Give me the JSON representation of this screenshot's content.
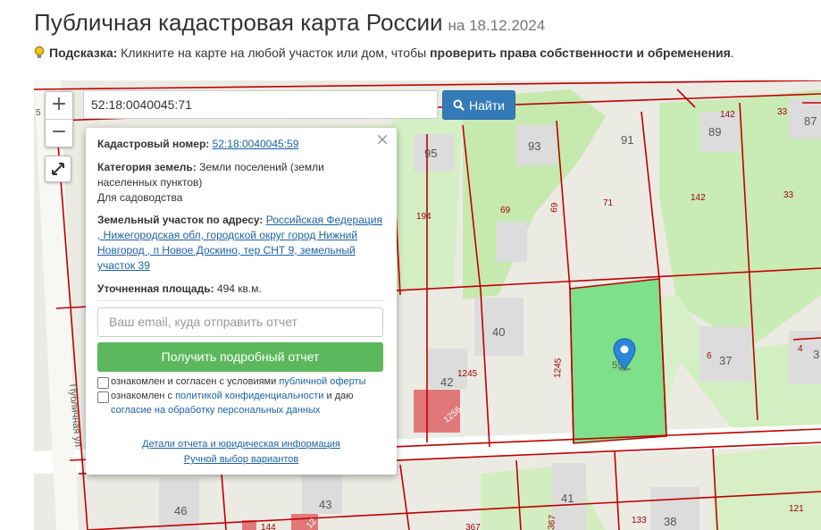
{
  "header": {
    "title": "Публичная кадастровая карта России",
    "date": "на 18.12.2024"
  },
  "hint": {
    "label": "Подсказка:",
    "text": " Кликните на карте на любой участок или дом, чтобы ",
    "bold": "проверить права собственности и обременения",
    "tail": "."
  },
  "search": {
    "value": "52:18:0040045:71",
    "button": "Найти"
  },
  "zoom": {
    "plus": "+",
    "minus": "−"
  },
  "popup": {
    "cad_label": "Кадастровый номер:",
    "cad_value": "52:18:0040045:59",
    "category_label": "Категория земель:",
    "category_value": "Земли поселений (земли населенных пунктов)",
    "purpose": "Для садоводства",
    "address_label": "Земельный участок по адресу:",
    "address_value": "Российская Федерация , Нижегородская обл, городской округ город Нижний Новгород , п Новое Доскино, тер СНТ 9, земельный участок 39",
    "area_label": "Уточненная площадь:",
    "area_value": "494 кв.м.",
    "email_placeholder": "Ваш email, куда отправить отчет",
    "report_button": "Получить подробный отчет",
    "agree1_text": "ознакомлен и согласен с условиями ",
    "agree1_link": "публичной оферты",
    "agree2_text": "ознакомлен с ",
    "agree2_link": "политикой конфиденциальности",
    "agree2_mid": " и даю",
    "agree2_link2": "согласие на обработку персональных данных",
    "details_link": "Детали отчета и юридическая информация",
    "manual_link": "Ручной выбор вариантов",
    "close": "×"
  },
  "map_labels": {
    "n95": "95",
    "n93": "93",
    "n91": "91",
    "n89": "89",
    "n142a": "142",
    "n33a": "33",
    "n87": "87",
    "n194": "194",
    "n69a": "69",
    "n69b": "69",
    "n71": "71",
    "n142b": "142",
    "n33b": "33",
    "n40": "40",
    "n42": "42",
    "n1245a": "1245",
    "n1245b": "1245",
    "n1256": "1256",
    "n59": "59",
    "n6": "6",
    "n37": "37",
    "n4": "4",
    "n3": "3",
    "n46": "46",
    "n43": "43",
    "n41": "41",
    "n133": "133",
    "n38": "38",
    "n121": "121",
    "n144": "144",
    "n12": "12",
    "n367a": "367",
    "n367b": "367",
    "n5": "5",
    "street": "Публичная ул"
  },
  "colors": {
    "selected_parcel": "#7ee08a",
    "parcel_border": "#c00000",
    "green_area": "#c8ebb4",
    "primary": "#337ab7",
    "success": "#5cb85c"
  }
}
